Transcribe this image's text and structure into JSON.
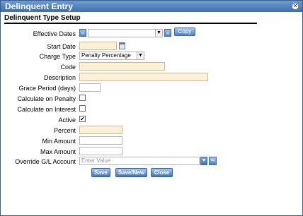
{
  "window": {
    "title": "Delinquent Entry"
  },
  "section": {
    "title": "Delinquent Type Setup"
  },
  "form": {
    "effective_dates": {
      "label": "Effective Dates",
      "value": "",
      "prev_glyph": "«",
      "next_glyph": "»",
      "copy_label": "Copy"
    },
    "start_date": {
      "label": "Start Date",
      "value": ""
    },
    "charge_type": {
      "label": "Charge Type",
      "value": "Penalty Percentage"
    },
    "code": {
      "label": "Code",
      "value": ""
    },
    "description": {
      "label": "Description",
      "value": ""
    },
    "grace_period": {
      "label": "Grace Period (days)",
      "value": ""
    },
    "calculate_on_penalty": {
      "label": "Calculate on Penalty",
      "checked": false
    },
    "calculate_on_interest": {
      "label": "Calculate on Interest",
      "checked": false
    },
    "active": {
      "label": "Active",
      "checked": true
    },
    "percent": {
      "label": "Percent",
      "value": ""
    },
    "min_amount": {
      "label": "Min Amount",
      "value": ""
    },
    "max_amount": {
      "label": "Max Amount",
      "value": ""
    },
    "override_gl": {
      "label": "Override G/L Account",
      "placeholder": "Enter Value"
    }
  },
  "actions": {
    "save": "Save",
    "save_new": "Save/New",
    "close": "Close"
  },
  "icons": {
    "close": "close-icon",
    "calendar": "calendar-icon",
    "dropdown": "chevron-down-icon",
    "lookup": "lookup-icon",
    "check": "✔"
  }
}
